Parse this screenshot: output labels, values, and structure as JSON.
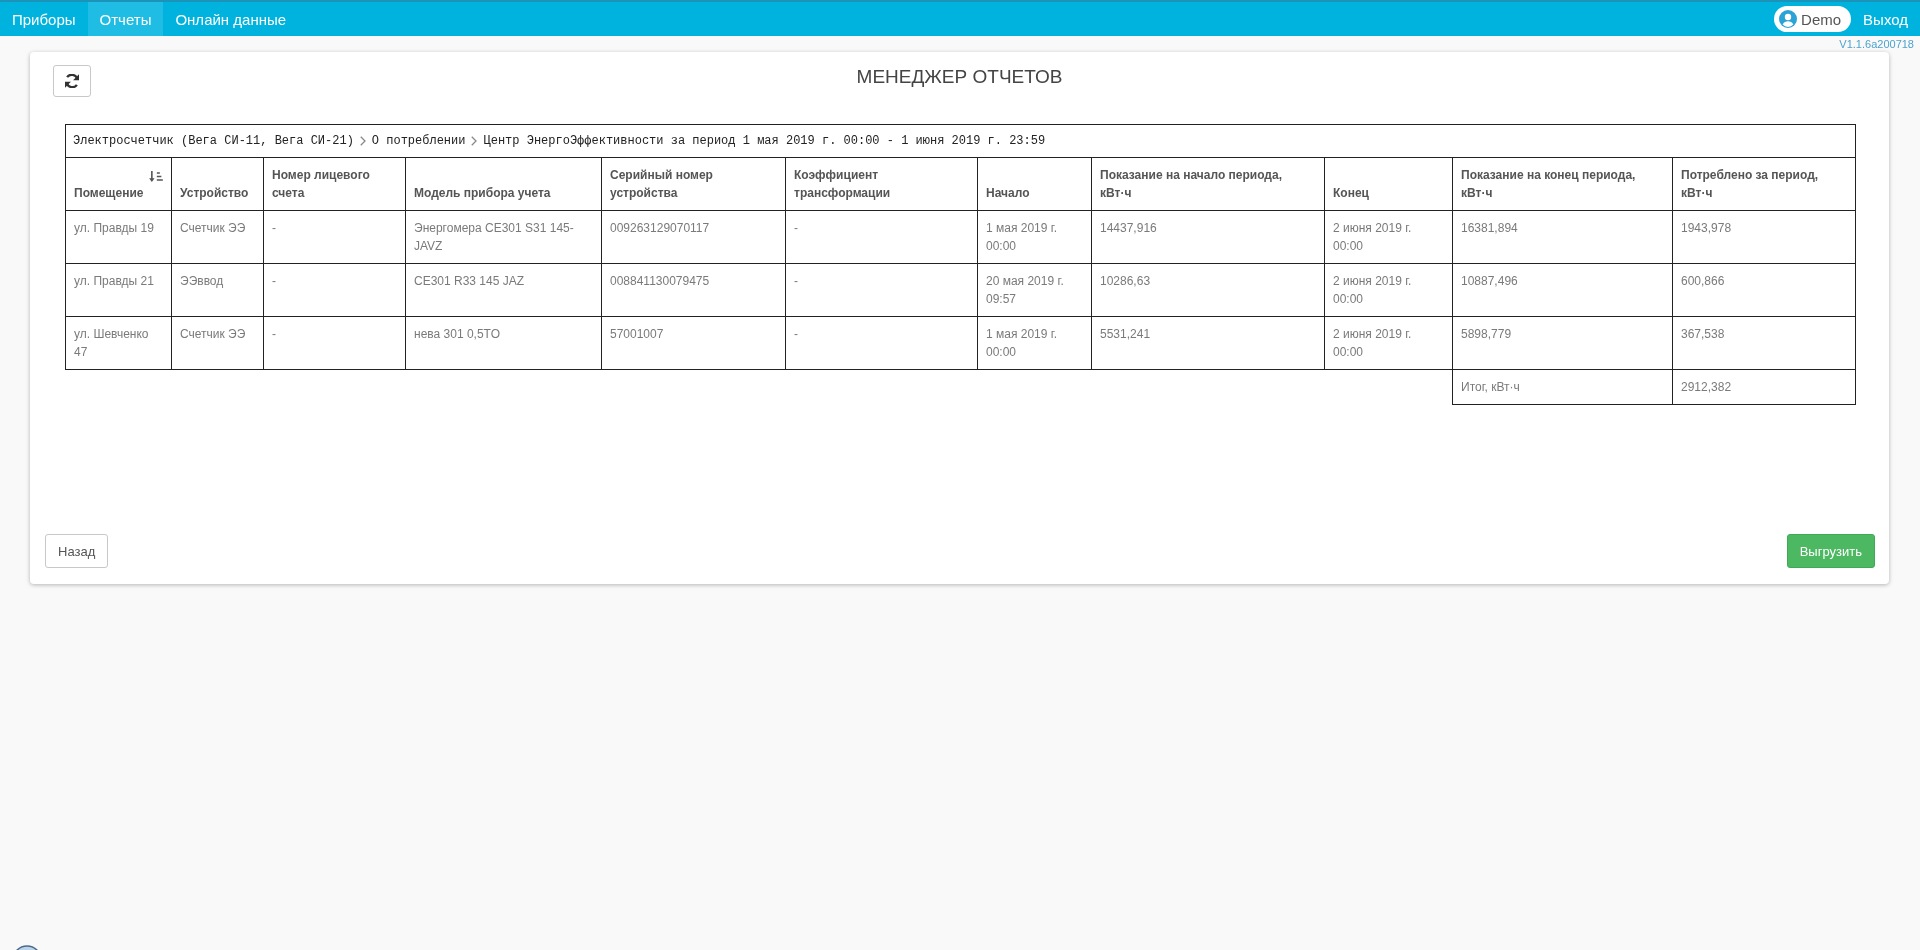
{
  "nav": {
    "items": [
      {
        "label": "Приборы",
        "selected": false
      },
      {
        "label": "Отчеты",
        "selected": true
      },
      {
        "label": "Онлайн данные",
        "selected": false
      }
    ]
  },
  "user": {
    "name": "Demo",
    "logout": "Выход"
  },
  "version": "V1.1.6a200718",
  "page": {
    "title": "МЕНЕДЖЕР ОТЧЕТОВ"
  },
  "report": {
    "breadcrumb": [
      "Электросчетчик (Вега СИ-11, Вега СИ-21)",
      "О потреблении",
      "Центр ЭнергоЭффективности за период 1 мая 2019 г. 00:00 - 1 июня 2019 г. 23:59"
    ],
    "columns": [
      {
        "label": "Помещение",
        "sorted": true
      },
      {
        "label": "Устройство",
        "sorted": false
      },
      {
        "label": "Номер лицевого счета",
        "sorted": false
      },
      {
        "label": "Модель прибора учета",
        "sorted": false
      },
      {
        "label": "Серийный номер устройства",
        "sorted": false
      },
      {
        "label": "Коэффициент трансформации",
        "sorted": false
      },
      {
        "label": "Начало",
        "sorted": false
      },
      {
        "label": "Показание на начало периода, кВт·ч",
        "sorted": false
      },
      {
        "label": "Конец",
        "sorted": false
      },
      {
        "label": "Показание на конец периода, кВт·ч",
        "sorted": false
      },
      {
        "label": "Потреблено за период, кВт·ч",
        "sorted": false
      }
    ],
    "rows": [
      [
        "ул. Правды 19",
        "Счетчик ЭЭ",
        "-",
        "Энергомера CE301 S31 145-JAVZ",
        "009263129070117",
        "-",
        "1 мая 2019 г. 00:00",
        "14437,916",
        "2 июня 2019 г. 00:00",
        "16381,894",
        "1943,978"
      ],
      [
        "ул. Правды 21",
        "ЭЭввод",
        "-",
        "CE301 R33 145 JAZ",
        "008841130079475",
        "-",
        "20 мая 2019 г. 09:57",
        "10286,63",
        "2 июня 2019 г. 00:00",
        "10887,496",
        "600,866"
      ],
      [
        "ул. Шевченко 47",
        "Счетчик ЭЭ",
        "-",
        "нева 301 0,5TO",
        "57001007",
        "-",
        "1 мая 2019 г. 00:00",
        "5531,241",
        "2 июня 2019 г. 00:00",
        "5898,779",
        "367,538"
      ]
    ],
    "total": {
      "label": "Итог, кВт·ч",
      "value": "2912,382"
    }
  },
  "buttons": [
    {
      "label": "Назад",
      "kind": "secondary"
    },
    {
      "label": "Выгрузить",
      "kind": "primary"
    }
  ]
}
